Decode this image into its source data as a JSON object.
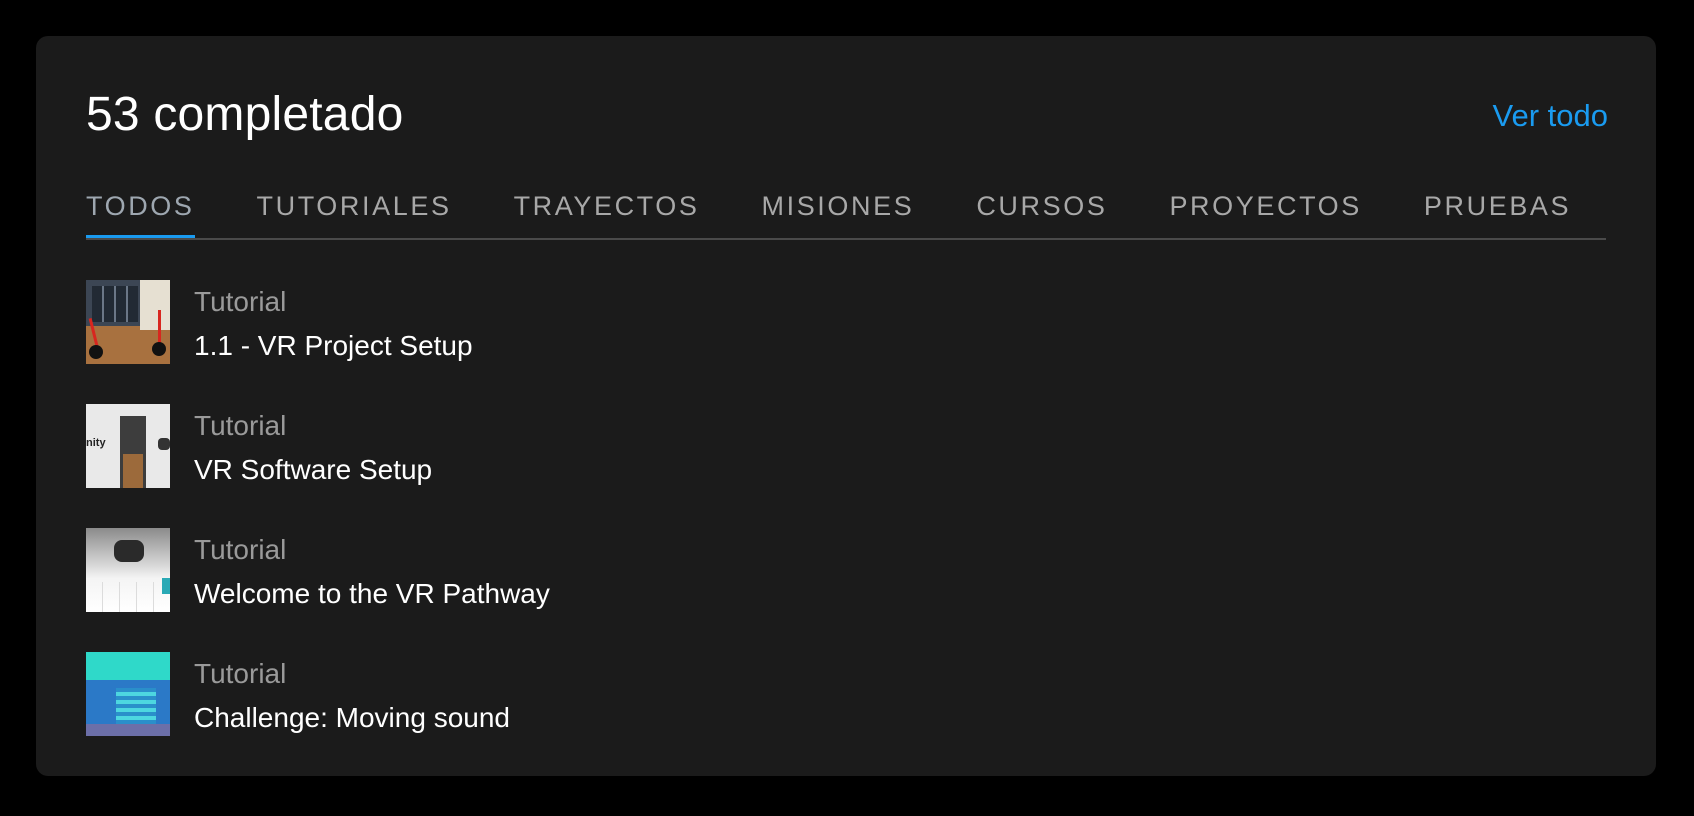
{
  "card": {
    "title": "53 completado",
    "see_all_label": "Ver todo"
  },
  "tabs": [
    {
      "label": "TODOS",
      "active": true
    },
    {
      "label": "TUTORIALES",
      "active": false
    },
    {
      "label": "TRAYECTOS",
      "active": false
    },
    {
      "label": "MISIONES",
      "active": false
    },
    {
      "label": "CURSOS",
      "active": false
    },
    {
      "label": "PROYECTOS",
      "active": false
    },
    {
      "label": "PRUEBAS",
      "active": false
    }
  ],
  "items": [
    {
      "kind": "Tutorial",
      "name": "1.1 - VR Project Setup"
    },
    {
      "kind": "Tutorial",
      "name": "VR Software Setup",
      "thumb_text": "nity"
    },
    {
      "kind": "Tutorial",
      "name": "Welcome to the VR Pathway"
    },
    {
      "kind": "Tutorial",
      "name": "Challenge: Moving sound"
    }
  ],
  "colors": {
    "background": "#000000",
    "card": "#1b1b1b",
    "accent": "#1a9bf0",
    "muted_text": "#9a9a9a"
  }
}
